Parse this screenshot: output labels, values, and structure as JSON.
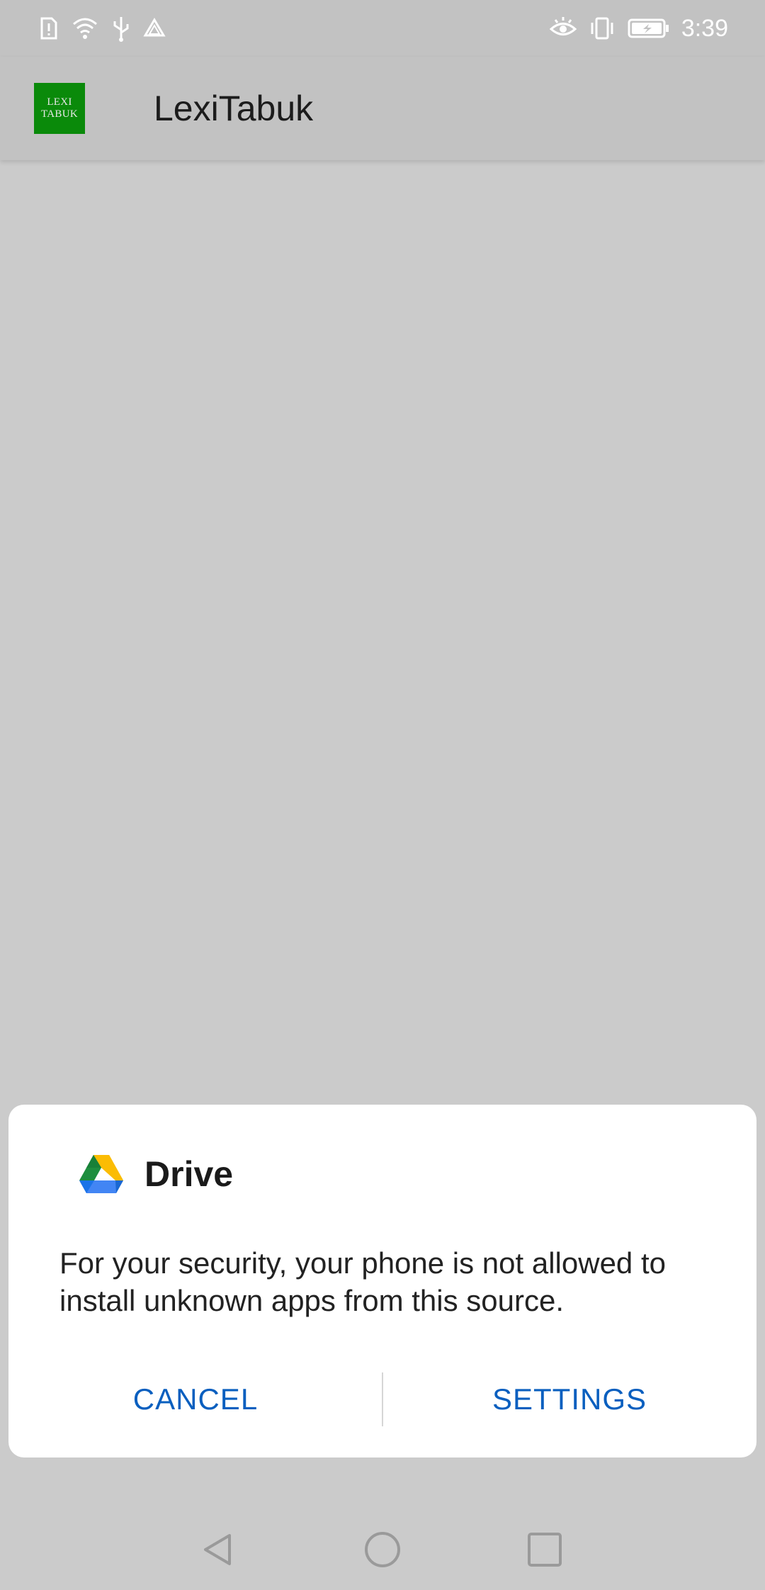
{
  "status_bar": {
    "time": "3:39",
    "left_icons": [
      "sim-alert-icon",
      "wifi-icon",
      "usb-icon",
      "drive-notification-icon"
    ],
    "right_icons": [
      "eye-comfort-icon",
      "vibrate-icon",
      "battery-charging-icon"
    ]
  },
  "app_bar": {
    "logo_line1": "LEXI",
    "logo_line2": "TABUK",
    "title": "LexiTabuk"
  },
  "dialog": {
    "icon": "google-drive-icon",
    "title": "Drive",
    "message": "For your security, your phone is not allowed to install unknown apps from this source.",
    "cancel_label": "CANCEL",
    "settings_label": "SETTINGS"
  },
  "nav_bar": {
    "icons": [
      "back-icon",
      "home-icon",
      "recents-icon"
    ]
  },
  "colors": {
    "accent": "#0a5fbf",
    "logo_bg": "#0a8a0a",
    "scrim": "#cbcbcb"
  }
}
